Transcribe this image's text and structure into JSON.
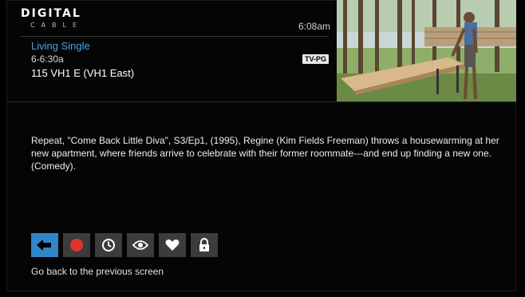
{
  "logo": {
    "main": "DIGITAL",
    "sub": "CABLE"
  },
  "clock": "6:08am",
  "program": {
    "title": "Living Single",
    "time_slot": "6-6:30a",
    "channel": "115 VH1 E (VH1 East)",
    "rating": "TV-PG"
  },
  "description": "Repeat, \"Come Back Little Diva\", S3/Ep1,  (1995), Regine (Kim Fields Freeman) throws a housewarming at her new apartment, where friends arrive to celebrate with their former roommate---and end up finding a new one. (Comedy).",
  "actions": [
    {
      "id": "back",
      "icon": "back-arrow-icon"
    },
    {
      "id": "record",
      "icon": "record-icon"
    },
    {
      "id": "reminder",
      "icon": "clock-icon"
    },
    {
      "id": "watch",
      "icon": "eye-icon"
    },
    {
      "id": "favorite",
      "icon": "heart-icon"
    },
    {
      "id": "lock",
      "icon": "lock-icon"
    }
  ],
  "hint": "Go back to the previous screen",
  "colors": {
    "accent": "#2f86c8",
    "title": "#4aa3df",
    "record": "#e0342c",
    "button": "#3c3c3c"
  }
}
